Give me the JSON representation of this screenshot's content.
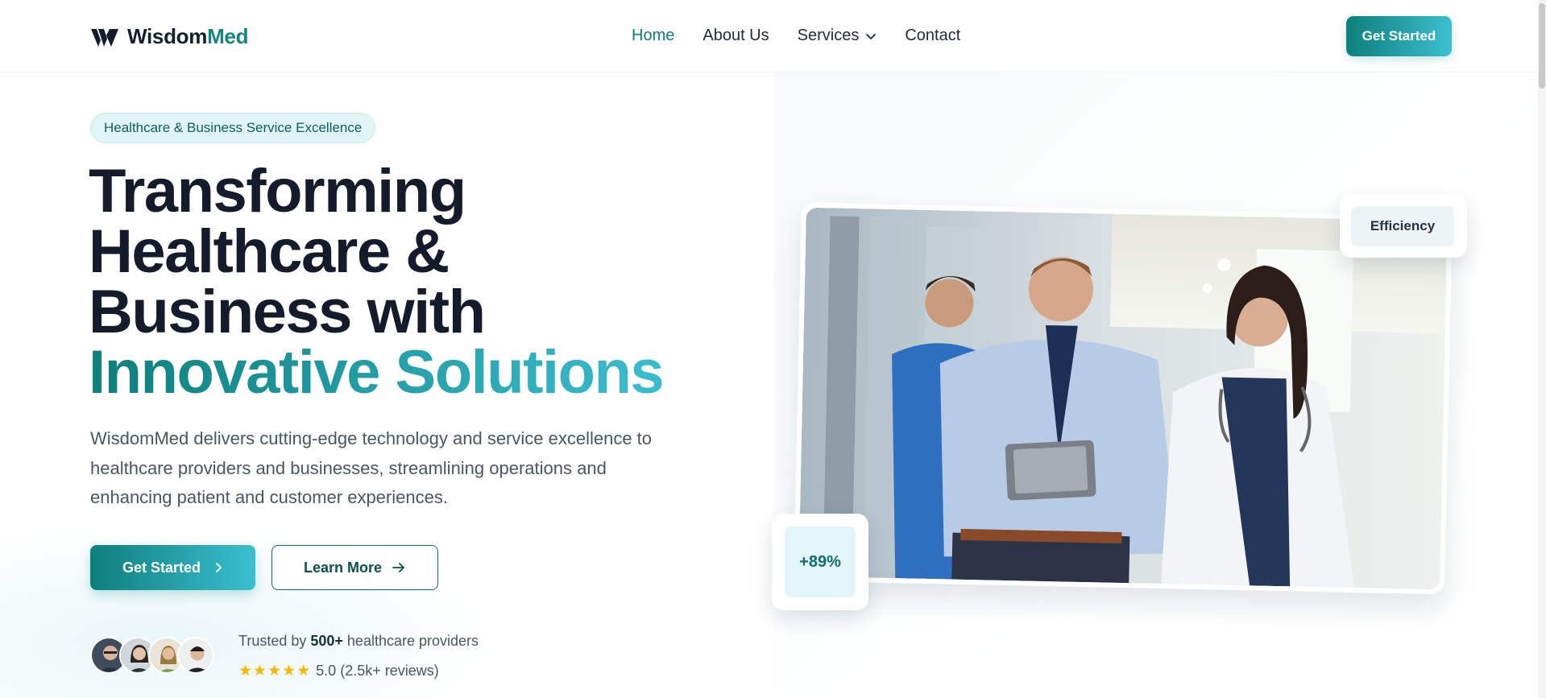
{
  "header": {
    "logo_primary": "Wisdom",
    "logo_accent": "Med",
    "nav": [
      {
        "label": "Home",
        "active": true
      },
      {
        "label": "About Us",
        "active": false
      },
      {
        "label": "Services",
        "active": false,
        "has_dropdown": true
      },
      {
        "label": "Contact",
        "active": false
      }
    ],
    "cta_label": "Get Started"
  },
  "hero": {
    "badge": "Healthcare & Business Service Excellence",
    "headline": {
      "line1": "Transforming",
      "line2": "Healthcare &",
      "line3": "Business with",
      "line4": "Innovative Solutions"
    },
    "description": "WisdomMed delivers cutting-edge technology and service excellence to healthcare providers and businesses, streamlining operations and enhancing patient and customer experiences.",
    "primary_button": "Get Started",
    "secondary_button": "Learn More",
    "trust": {
      "prefix": "Trusted by ",
      "count": "500+",
      "suffix": " healthcare providers",
      "stars": "★★★★★",
      "rating": "5.0 (2.5k+ reviews)"
    },
    "image_alt": "Medical staff talking in a hospital corridor",
    "float_cards": {
      "efficiency": "Efficiency",
      "stat": "+89%"
    }
  },
  "colors": {
    "brand_teal": "#0e7f7b",
    "brand_cyan": "#3bbfd0",
    "text_dark": "#141b2b",
    "star": "#f5b800"
  }
}
